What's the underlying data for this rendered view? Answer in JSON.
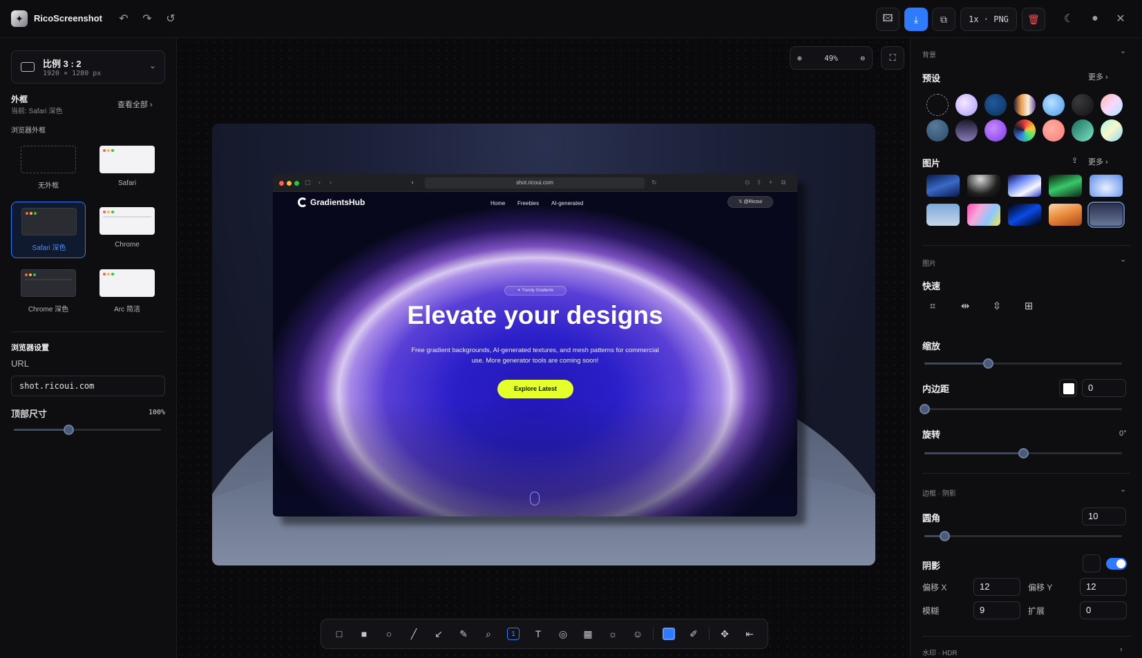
{
  "app": {
    "name": "RicoScreenshot"
  },
  "toolbar": {
    "format": "1x · PNG"
  },
  "left": {
    "ratio": {
      "title": "比例 3 : 2",
      "size": "1920 × 1280 px"
    },
    "frame_title": "外框",
    "frame_current": "当前: Safari 深色",
    "view_all": "查看全部",
    "browser_frame_label": "浏览器外框",
    "frames": [
      "无外框",
      "Safari",
      "Safari 深色",
      "Chrome",
      "Chrome 深色",
      "Arc 简洁"
    ],
    "settings_title": "浏览器设置",
    "url_label": "URL",
    "url_value": "shot.ricoui.com",
    "top_size_label": "顶部尺寸",
    "top_size_value": "100%",
    "top_size_level": 0.37
  },
  "canvas": {
    "zoom": "49%"
  },
  "preview": {
    "address": "shot.ricoui.com",
    "brand": "GradientsHub",
    "nav": [
      "Home",
      "Freebies",
      "AI-generated"
    ],
    "x_button": "@Ricoui",
    "pill": "Trendy Gradients",
    "hero": "Elevate your designs",
    "sub": "Free gradient backgrounds, AI-generated textures, and mesh patterns for commercial use. More generator tools are coming soon!",
    "cta": "Explore Latest"
  },
  "right": {
    "bg_section": "背景",
    "presets_label": "预设",
    "more": "更多",
    "images_label": "图片",
    "image_section": "图片",
    "quick_label": "快速",
    "scale_label": "缩放",
    "scale_level": 0.32,
    "padding_label": "内边距",
    "padding_value": "0",
    "padding_level": 0.0,
    "rotate_label": "旋转",
    "rotate_value": "0°",
    "rotate_level": 0.5,
    "border_section": "边框 · 阴影",
    "radius_label": "圆角",
    "radius_value": "10",
    "radius_level": 0.1,
    "shadow_label": "阴影",
    "offset_x_label": "偏移 X",
    "offset_x": "12",
    "offset_y_label": "偏移 Y",
    "offset_y": "12",
    "blur_label": "模糊",
    "blur": "9",
    "spread_label": "扩展",
    "spread": "0",
    "watermark_section": "水印 · HDR"
  },
  "colors": {
    "accent": "#2f7bff",
    "cta": "#e4ff2a",
    "danger": "#ff4d4d"
  }
}
